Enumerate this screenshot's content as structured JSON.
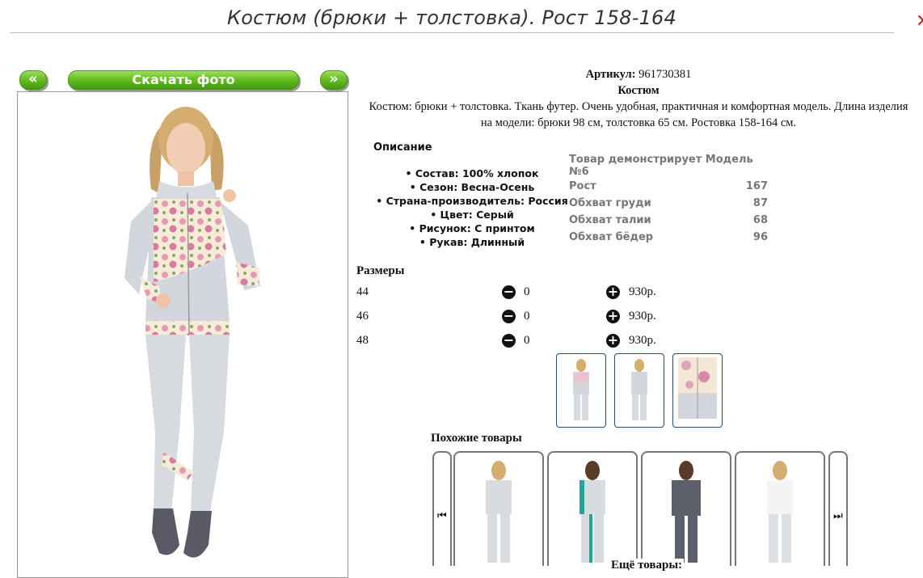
{
  "header": {
    "title": "Костюм (брюки + толстовка). Рост 158-164"
  },
  "photo_nav": {
    "prev_label": "«",
    "download_label": "Скачать фото",
    "next_label": "»"
  },
  "product": {
    "sku_label": "Артикул:",
    "sku": "961730381",
    "type": "Костюм",
    "summary": "Костюм: брюки + толстовка. Ткань футер. Очень удобная, практичная и комфортная модель. Длина изделия на модели: брюки 98 см, толстовка 65 см. Ростовка 158-164 см."
  },
  "description": {
    "heading": "Описание",
    "items": [
      "Состав: 100% хлопок",
      "Сезон: Весна-Осень",
      "Страна-производитель: Россия",
      "Цвет: Серый",
      "Рисунок: С принтом",
      "Рукав: Длинный"
    ]
  },
  "model": {
    "heading": "Товар демонстрирует Модель №6",
    "rows": [
      {
        "label": "Рост",
        "value": "167"
      },
      {
        "label": "Обхват груди",
        "value": "87"
      },
      {
        "label": "Обхват талии",
        "value": "68"
      },
      {
        "label": "Обхват бёдер",
        "value": "96"
      }
    ]
  },
  "sizes": {
    "heading": "Размеры",
    "rows": [
      {
        "size": "44",
        "qty": "0",
        "price": "930р."
      },
      {
        "size": "46",
        "qty": "0",
        "price": "930р."
      },
      {
        "size": "48",
        "qty": "0",
        "price": "930р."
      }
    ]
  },
  "similar": {
    "heading": "Похожие товары",
    "more_label": "Ещё товары:"
  },
  "icons": {
    "minus": "minus-circle-icon",
    "plus": "plus-circle-icon",
    "prev": "skip-prev-icon",
    "next": "skip-next-icon"
  }
}
